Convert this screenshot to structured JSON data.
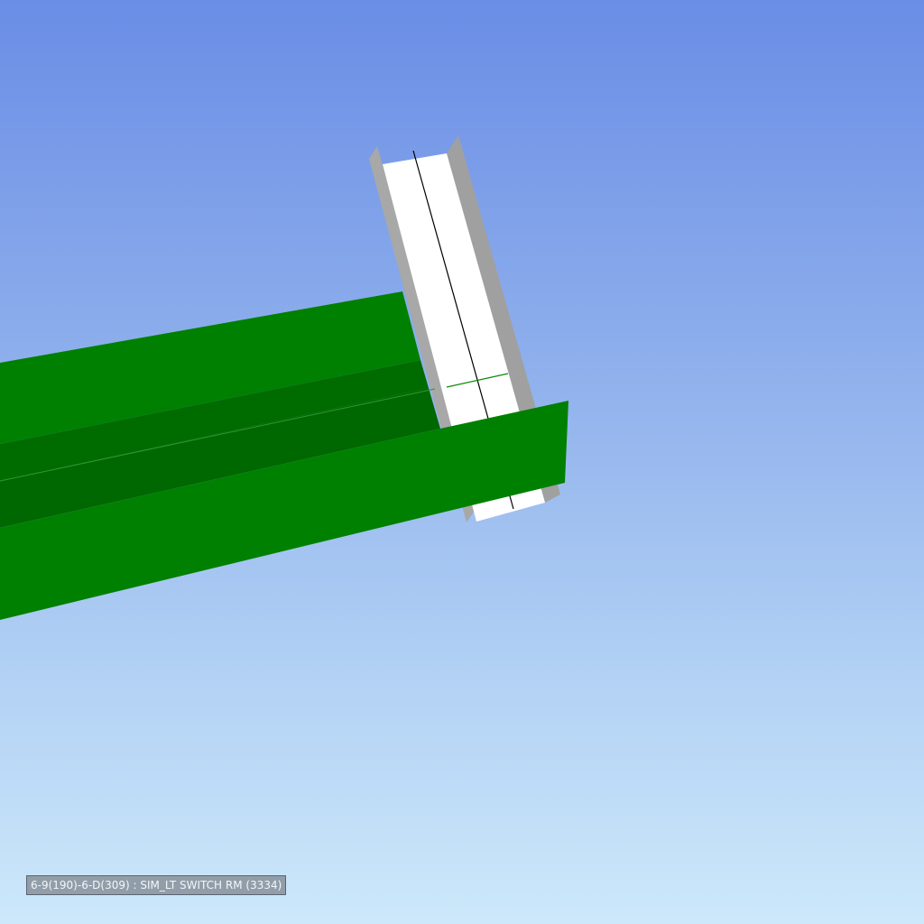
{
  "viewport": {
    "background_top": "#6a8de6",
    "background_bottom": "#cde8fa"
  },
  "model": {
    "green_member_color": "#008000",
    "green_member_shadow": "#006a00",
    "white_member_color": "#ffffff",
    "white_member_edge": "#a0a0a0"
  },
  "status": {
    "selection_label": "6-9(190)-6-D(309) : SIM_LT SWITCH RM (3334)"
  }
}
